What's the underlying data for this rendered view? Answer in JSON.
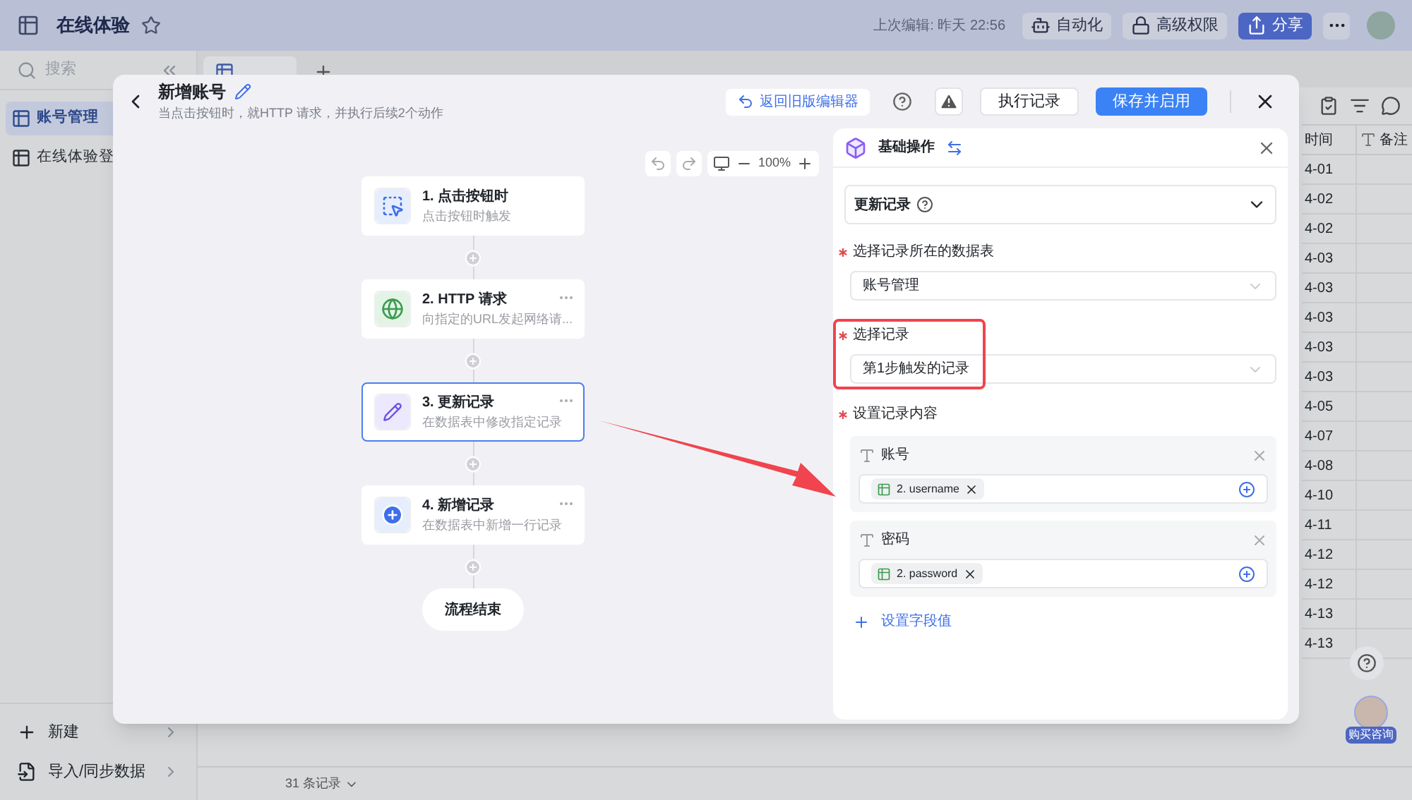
{
  "app": {
    "title": "在线体验",
    "last_edit": "上次编辑: 昨天 22:56",
    "actions": [
      {
        "kind": "automation",
        "label": "自动化"
      },
      {
        "kind": "permission",
        "label": "高级权限"
      },
      {
        "kind": "share",
        "label": "分享"
      }
    ]
  },
  "sidebar": {
    "search_placeholder": "搜索",
    "items": [
      {
        "label": "账号管理",
        "selected": true
      },
      {
        "label": "在线体验登",
        "selected": false
      }
    ],
    "bottom": [
      {
        "kind": "new",
        "label": "新建"
      },
      {
        "kind": "import",
        "label": "导入/同步数据"
      }
    ]
  },
  "table": {
    "columns": [
      "时间",
      "备注"
    ],
    "dates": [
      "4-01",
      "4-02",
      "4-02",
      "4-03",
      "4-03",
      "4-03",
      "4-03",
      "4-03",
      "4-05",
      "4-07",
      "4-08",
      "4-10",
      "4-11",
      "4-12",
      "4-12",
      "4-13",
      "4-13"
    ],
    "footer": "31 条记录"
  },
  "consult": "购买咨询",
  "modal": {
    "title": "新增账号",
    "subtitle": "当点击按钮时，就HTTP 请求，并执行后续2个动作",
    "legacy": "返回旧版编辑器",
    "log": "执行记录",
    "save": "保存并启用",
    "zoom": "100%",
    "steps": [
      {
        "kind": "trigger",
        "title": "1. 点击按钮时",
        "desc": "点击按钮时触发",
        "selected": false,
        "menu": false
      },
      {
        "kind": "http",
        "title": "2. HTTP 请求",
        "desc": "向指定的URL发起网络请...",
        "selected": false,
        "menu": true
      },
      {
        "kind": "update",
        "title": "3. 更新记录",
        "desc": "在数据表中修改指定记录",
        "selected": true,
        "menu": true
      },
      {
        "kind": "add",
        "title": "4. 新增记录",
        "desc": "在数据表中新增一行记录",
        "selected": false,
        "menu": true
      }
    ],
    "end": "流程结束"
  },
  "panel": {
    "title": "基础操作",
    "action": "更新记录",
    "inputs": [
      {
        "label": "选择记录所在的数据表",
        "value": "账号管理",
        "required": true
      },
      {
        "label": "选择记录",
        "value": "第1步触发的记录",
        "required": true
      }
    ],
    "content": {
      "label": "设置记录内容",
      "required": true
    },
    "fields": [
      {
        "name": "账号",
        "token": "2. username"
      },
      {
        "name": "密码",
        "token": "2. password"
      }
    ],
    "add": "设置字段值"
  }
}
